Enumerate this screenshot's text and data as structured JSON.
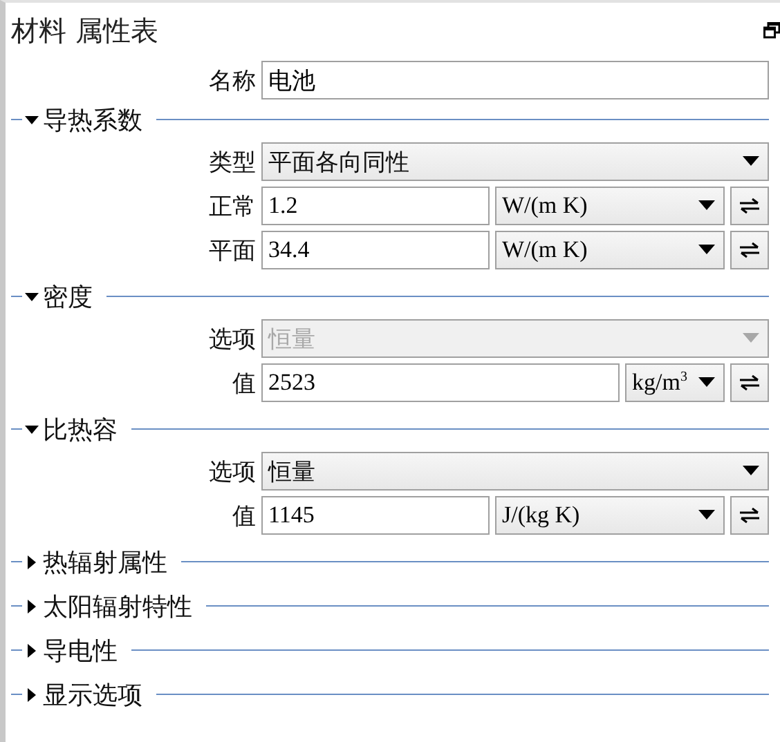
{
  "panel": {
    "title": "材料 属性表"
  },
  "name_field": {
    "label": "名称",
    "value": "电池"
  },
  "sections": [
    {
      "title": "导热系数",
      "expanded": true,
      "rows": [
        {
          "kind": "select",
          "label": "类型",
          "value": "平面各向同性",
          "disabled": false
        },
        {
          "kind": "quantity",
          "label": "正常",
          "value": "1.2",
          "unit": "W/(m K)"
        },
        {
          "kind": "quantity",
          "label": "平面",
          "value": "34.4",
          "unit": "W/(m K)"
        }
      ]
    },
    {
      "title": "密度",
      "expanded": true,
      "rows": [
        {
          "kind": "select",
          "label": "选项",
          "value": "恒量",
          "disabled": true
        },
        {
          "kind": "quantity",
          "label": "值",
          "value": "2523",
          "unit": "kg/m$^{3}$"
        }
      ]
    },
    {
      "title": "比热容",
      "expanded": true,
      "rows": [
        {
          "kind": "select",
          "label": "选项",
          "value": "恒量",
          "disabled": false
        },
        {
          "kind": "quantity",
          "label": "值",
          "value": "1145",
          "unit": "J/(kg K)"
        }
      ]
    },
    {
      "title": "热辐射属性",
      "expanded": false
    },
    {
      "title": "太阳辐射特性",
      "expanded": false
    },
    {
      "title": "导电性",
      "expanded": false
    },
    {
      "title": "显示选项",
      "expanded": false
    }
  ]
}
